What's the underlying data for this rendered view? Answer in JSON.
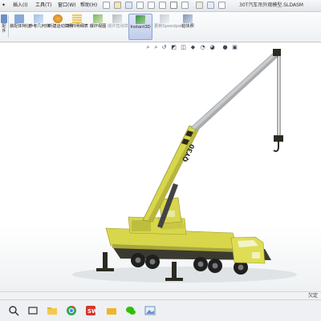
{
  "menu": {
    "items": [
      "插入(I)",
      "工具(T)",
      "窗口(W)",
      "帮助(H)"
    ],
    "pin_icon": "pin-icon"
  },
  "document_title": "30T汽车吊外观模型.SLDASM",
  "ribbon": {
    "left_labels": [
      "装配体特征",
      "参考几何体",
      "新建运动算例",
      "材料明细表",
      "爆炸视图",
      "爆炸直线草图",
      "Instant3D",
      "更新Speedpak",
      "拍快照"
    ],
    "first_button": {
      "label_top": "配",
      "label_bottom": "件"
    }
  },
  "status": {
    "text": "欠定"
  },
  "colors": {
    "crane_yellow": "#d8d64a",
    "crane_dark": "#2b2b22",
    "boom_gray": "#c9cbcd",
    "accent_blue": "#1f6fd1"
  },
  "boom_text": "QY30"
}
